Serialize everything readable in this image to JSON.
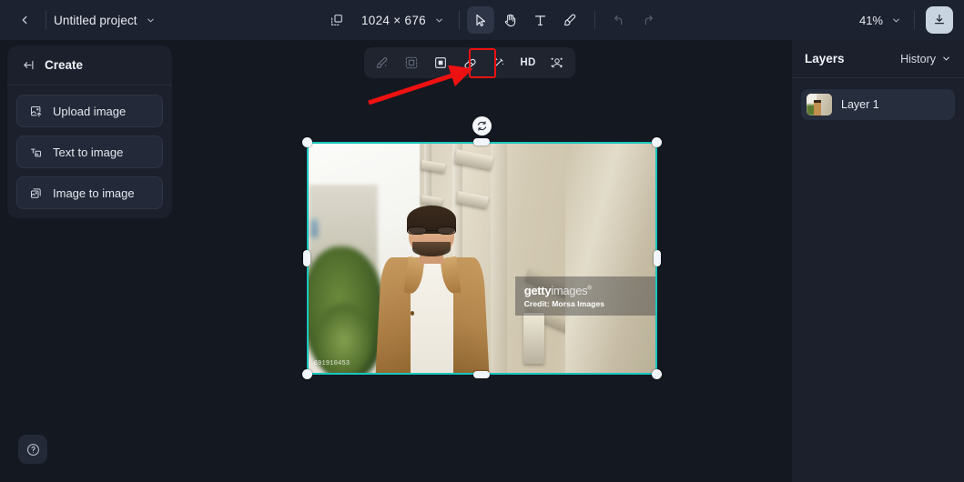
{
  "topbar": {
    "back_icon": "chevron-left-icon",
    "project_title": "Untitled project",
    "project_chevron": "chevron-down-icon",
    "canvas_size_icon": "canvas-resize-icon",
    "canvas_size": "1024 × 676",
    "size_chevron": "chevron-down-icon",
    "tools": [
      {
        "name": "select-tool",
        "icon": "cursor-arrow-icon",
        "label": "",
        "active": true,
        "disabled": false
      },
      {
        "name": "hand-tool",
        "icon": "hand-icon",
        "label": "",
        "active": false,
        "disabled": false
      },
      {
        "name": "text-tool",
        "icon": "text-t-icon",
        "label": "",
        "active": false,
        "disabled": false
      },
      {
        "name": "brush-tool",
        "icon": "paintbrush-icon",
        "label": "",
        "active": false,
        "disabled": false
      },
      {
        "name": "undo-tool",
        "icon": "undo-arrow-icon",
        "label": "",
        "active": false,
        "disabled": true
      },
      {
        "name": "redo-tool",
        "icon": "redo-arrow-icon",
        "label": "",
        "active": false,
        "disabled": true
      }
    ],
    "zoom_level": "41%",
    "zoom_chevron": "chevron-down-icon",
    "download_icon": "download-icon"
  },
  "left_panel": {
    "collapse_icon": "collapse-left-icon",
    "title": "Create",
    "items": [
      {
        "label": "Upload image",
        "icon": "upload-image-icon"
      },
      {
        "label": "Text to image",
        "icon": "text-to-image-icon"
      },
      {
        "label": "Image to image",
        "icon": "image-to-image-icon"
      }
    ]
  },
  "help": {
    "icon": "question-circle-icon"
  },
  "float_toolbar": {
    "buttons": [
      {
        "name": "magic-erase-button",
        "icon": "magic-eraser-icon",
        "label": "",
        "dim": true,
        "highlighted": false
      },
      {
        "name": "expand-button",
        "icon": "expand-frame-icon",
        "label": "",
        "dim": true,
        "highlighted": false
      },
      {
        "name": "crop-button",
        "icon": "crop-select-icon",
        "label": "",
        "dim": false,
        "highlighted": false
      },
      {
        "name": "eraser-button",
        "icon": "eraser-icon",
        "label": "",
        "dim": false,
        "highlighted": true
      },
      {
        "name": "magic-wand-button",
        "icon": "magic-wand-icon",
        "label": "",
        "dim": false,
        "highlighted": false
      },
      {
        "name": "hd-button",
        "icon": "hd-text-icon",
        "label": "HD",
        "dim": false,
        "highlighted": false
      },
      {
        "name": "retouch-face-button",
        "icon": "face-retouch-icon",
        "label": "",
        "dim": false,
        "highlighted": false
      }
    ]
  },
  "annotation": {
    "highlight_color": "#ee1111",
    "arrow_name": "red-pointer-arrow",
    "box_name": "red-highlight-box"
  },
  "canvas": {
    "rotate_icon": "rotate-handle-icon",
    "selection_color": "#19c6bf",
    "image": {
      "watermark_brand_bold": "getty",
      "watermark_brand_light": "images",
      "watermark_credit": "Credit: Morsa Images",
      "image_id": "691910453",
      "alt": "Smiling bearded man in glasses and tan jacket standing on a city street"
    }
  },
  "right_panel": {
    "title": "Layers",
    "history_label": "History",
    "history_chevron": "chevron-down-icon",
    "layers": [
      {
        "name": "Layer 1",
        "thumbnail": "layer-thumbnail"
      }
    ]
  }
}
